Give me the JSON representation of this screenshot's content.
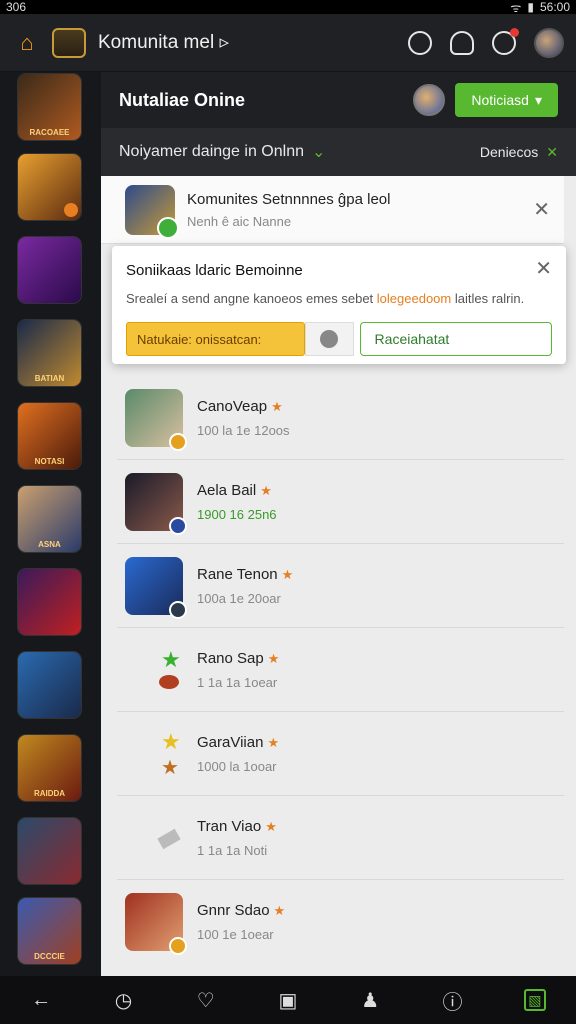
{
  "status": {
    "time_left": "306",
    "time_right": "56:00"
  },
  "app": {
    "title": "Komunita mel ▹"
  },
  "main": {
    "title": "Nutaliae Onine",
    "button": "Noticiasd",
    "subbar": {
      "left": "Noiyamer dainge in Onlnn",
      "right": "Deniecos"
    }
  },
  "notice": {
    "title": "Komunites Setnnnnes ĝpa leol",
    "subtitle": "Nenh ê aic Nanne"
  },
  "dialog": {
    "title": "Soniikaas ldaric Bemoinne",
    "text_before": "Srealeí a send angne kanoeos emes sebet ",
    "text_highlight": "lolegeedoom",
    "text_after": " laitles ralrin.",
    "input_value": "Natukaie: onissatcan:",
    "button": "Raceiahatat"
  },
  "rows": [
    {
      "name": "CanoVeap",
      "meta": "100 la 1e 12oos",
      "meta_green": false
    },
    {
      "name": "Aela Bail",
      "meta": "1900  16 25n6",
      "meta_green": true
    },
    {
      "name": "Rane Tenon",
      "meta": "100a 1e 20oar",
      "meta_green": false
    },
    {
      "name": "Rano Sap",
      "meta": "1 1a 1a 1oear",
      "meta_green": false
    },
    {
      "name": "GaraViian",
      "meta": "1000 la 1ooar",
      "meta_green": false
    },
    {
      "name": "Tran Viao",
      "meta": "1 1a 1a Noti",
      "meta_green": false
    },
    {
      "name": "Gnnr Sdao",
      "meta": "100 1e 1oear",
      "meta_green": false
    }
  ],
  "tiles": [
    "RACOAEE",
    "",
    "",
    "BATIAN",
    "NOTASI",
    "ASNA",
    "",
    "",
    "RAIDDA",
    "",
    "DCCCIE"
  ],
  "colors": {
    "accent_green": "#58b830",
    "highlight_orange": "#e67e22",
    "input_yellow": "#f5c33a"
  }
}
